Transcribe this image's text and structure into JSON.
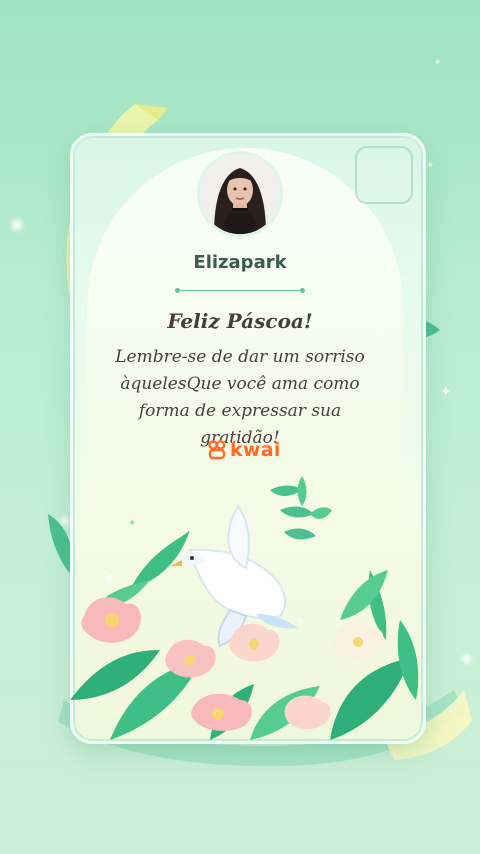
{
  "card": {
    "username": "Elizapark",
    "title": "Feliz Páscoa!",
    "message": "Lembre-se de dar um sorriso àquelesQue você ama como forma de expressar sua gratidão!",
    "brand": "kwai"
  },
  "colors": {
    "background": "#b8ecd0",
    "brand": "#ff6b26",
    "divider": "#69c49a",
    "text": "#4a3d3a"
  },
  "icons": [
    "sparkle-icon",
    "kwai-logo-icon",
    "dove-icon",
    "flower-icon",
    "leaf-icon"
  ]
}
